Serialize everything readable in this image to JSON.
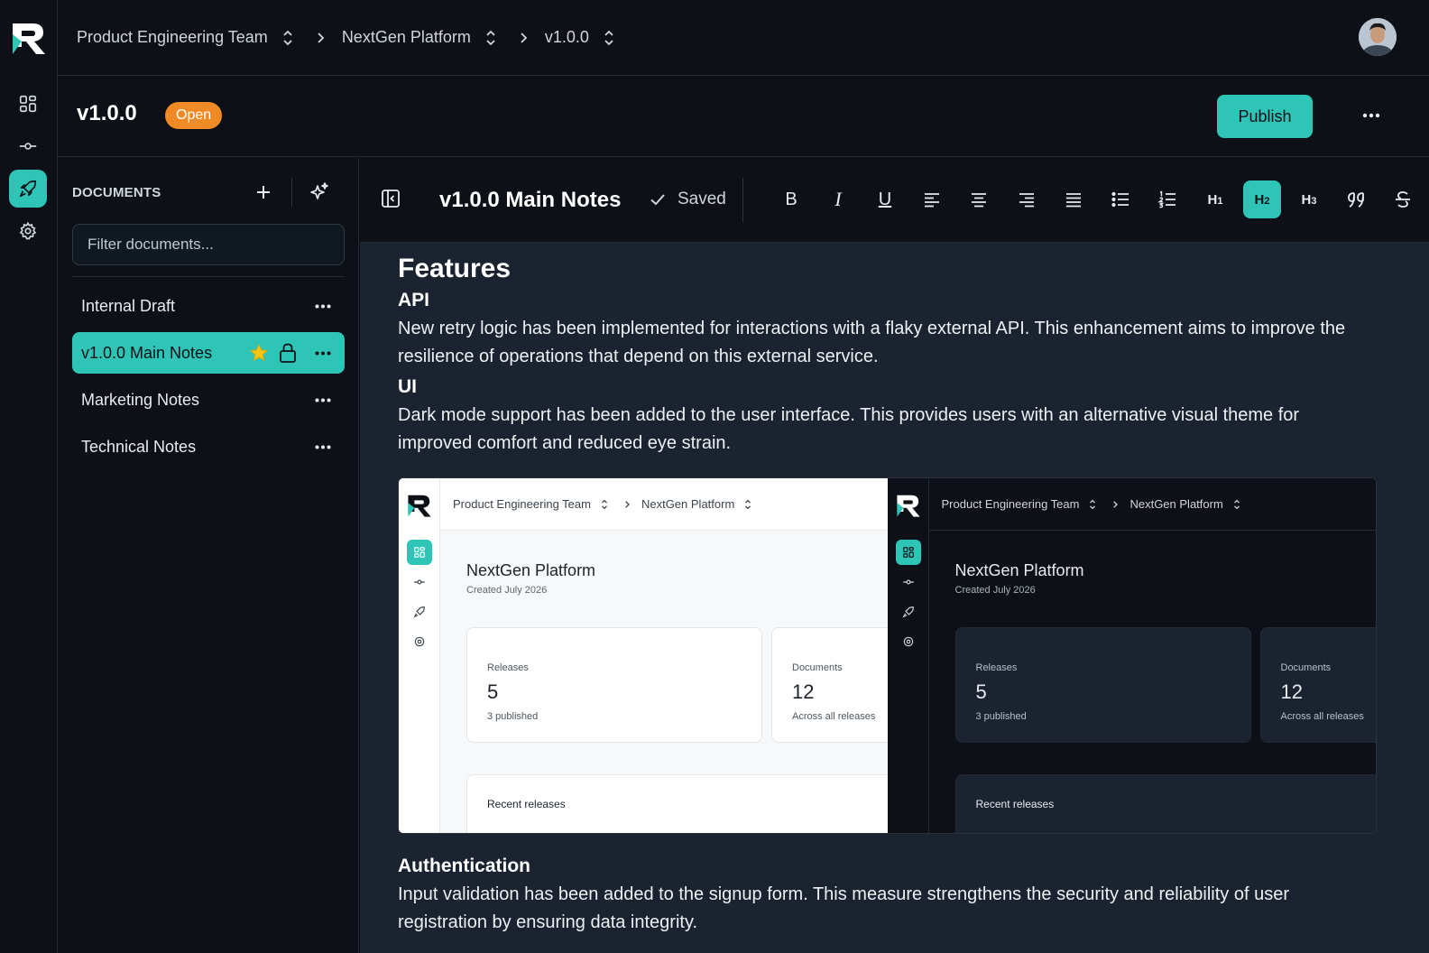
{
  "breadcrumb": {
    "team": "Product Engineering Team",
    "project": "NextGen Platform",
    "release": "v1.0.0"
  },
  "release": {
    "version": "v1.0.0",
    "status": "Open",
    "publish_label": "Publish"
  },
  "documents": {
    "title": "DOCUMENTS",
    "filter_placeholder": "Filter documents...",
    "items": [
      {
        "label": "Internal Draft",
        "active": false
      },
      {
        "label": "v1.0.0 Main Notes",
        "active": true,
        "starred": true,
        "locked": true
      },
      {
        "label": "Marketing Notes",
        "active": false
      },
      {
        "label": "Technical Notes",
        "active": false
      }
    ]
  },
  "editor": {
    "doc_title": "v1.0.0 Main Notes",
    "save_status": "Saved",
    "toolbar": {
      "bold": "B",
      "italic": "I",
      "underline": "U",
      "h1": "H1",
      "h2": "H2",
      "h3": "H3",
      "active": "H2"
    },
    "body": {
      "h_features": "Features",
      "h_api": "API",
      "p_api": "New retry logic has been implemented for interactions with a flaky external API. This enhancement aims to improve the resilience of operations that depend on this external service.",
      "h_ui": "UI",
      "p_ui": "Dark mode support has been added to the user interface. This provides users with an alternative visual theme for improved comfort and reduced eye strain.",
      "h_auth": "Authentication",
      "p_auth": "Input validation has been added to the signup form. This measure strengthens the security and reliability of user registration by ensuring data integrity."
    },
    "embedded_screenshot": {
      "team": "Product Engineering Team",
      "project": "NextGen Platform",
      "title": "NextGen Platform",
      "created": "Created July 2026",
      "releases_label": "Releases",
      "releases_value": "5",
      "releases_note": "3 published",
      "documents_label": "Documents",
      "documents_value": "12",
      "documents_note": "Across all releases",
      "recent_label": "Recent releases"
    }
  },
  "colors": {
    "accent": "#2ec4b6",
    "status_open": "#f08a24",
    "background": "#0d1117",
    "editor_bg": "#1b2230"
  }
}
